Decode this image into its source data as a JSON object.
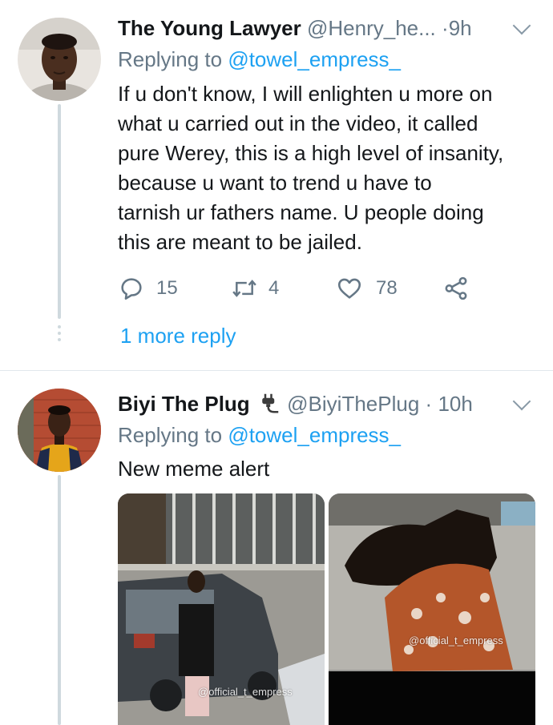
{
  "tweets": [
    {
      "name": "The Young Lawyer",
      "handle": "@Henry_he...",
      "separator": "·",
      "time": "9h",
      "replying_prefix": "Replying to",
      "replying_to": "@towel_empress_",
      "text_lines": [
        "If u don't know, I will enlighten u more on",
        "what u carried out in the video, it called",
        "pure Werey, this is a high level of insanity,",
        "because u want to trend u have to",
        "tarnish ur fathers name. U people doing",
        "this are meant to be jailed."
      ],
      "replies": "15",
      "retweets": "4",
      "likes": "78",
      "more_replies": "1 more reply"
    },
    {
      "name": "Biyi The Plug",
      "handle": "@BiyiThePlug",
      "separator": "·",
      "time": "10h",
      "replying_prefix": "Replying to",
      "replying_to": "@towel_empress_",
      "text": "New meme alert",
      "media": [
        {
          "watermark": "@official_t_empress"
        },
        {
          "watermark": "@official_t_empress"
        }
      ]
    }
  ],
  "icons": {
    "reply": "reply-icon",
    "retweet": "retweet-icon",
    "like": "heart-icon",
    "share": "share-icon",
    "more": "chevron-down-icon",
    "plug": "plug-emoji-icon"
  },
  "colors": {
    "link": "#1da1f2",
    "secondary": "#657786",
    "text": "#14171a"
  }
}
